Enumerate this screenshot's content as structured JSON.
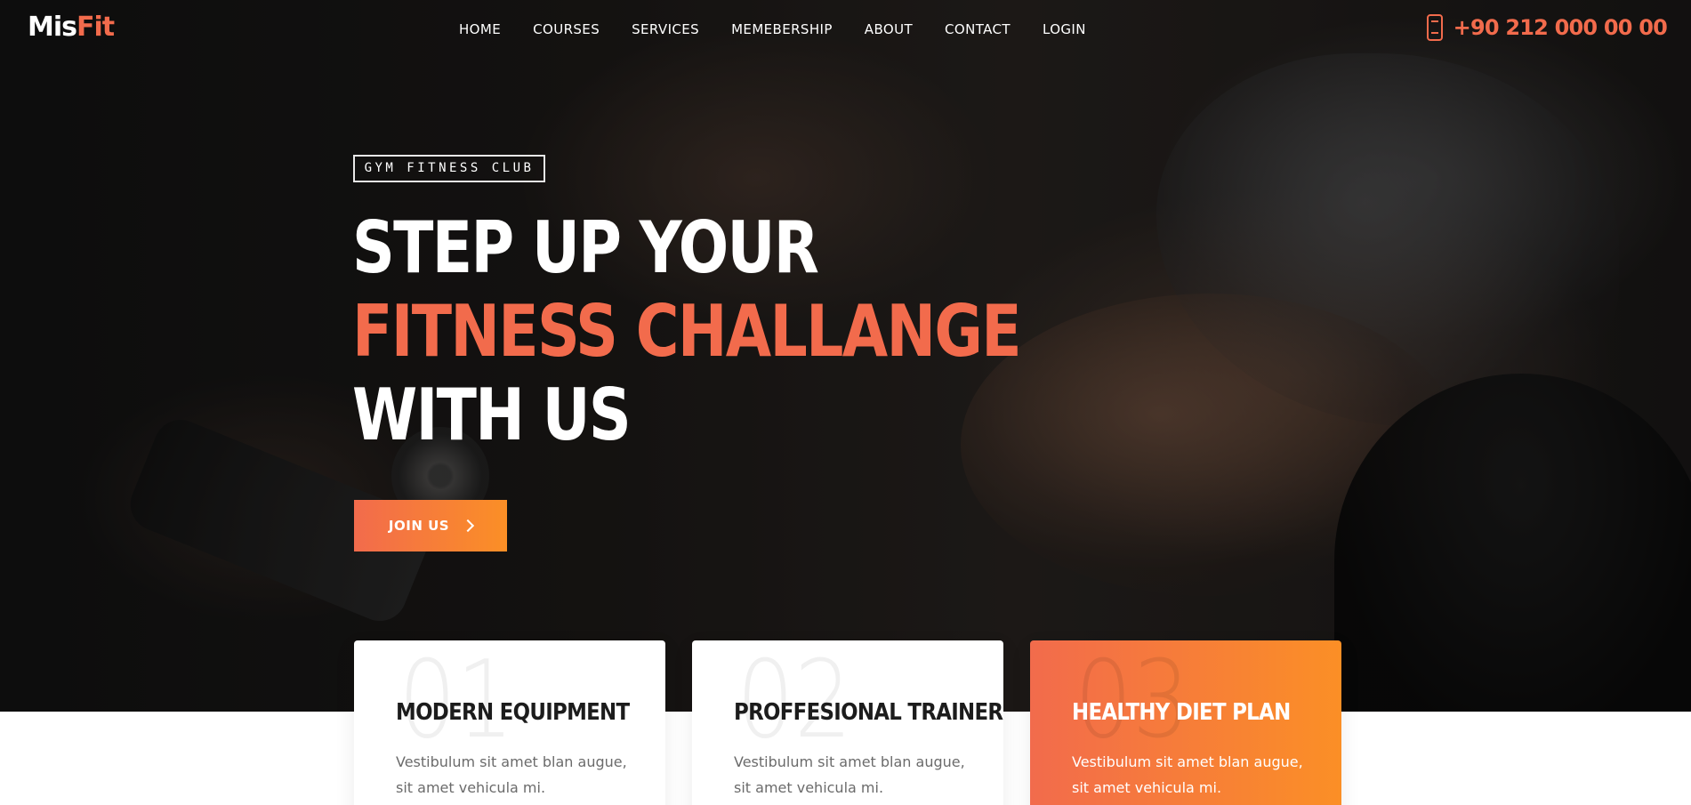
{
  "brand": {
    "logo_part1": "Mis",
    "logo_part2": "Fit"
  },
  "nav": {
    "items": [
      {
        "label": "HOME"
      },
      {
        "label": "COURSES"
      },
      {
        "label": "SERVICES"
      },
      {
        "label": "MEMEBERSHIP"
      },
      {
        "label": "ABOUT"
      },
      {
        "label": "CONTACT"
      },
      {
        "label": "LOGIN"
      }
    ]
  },
  "contact": {
    "phone": "+90 212 000 00 00",
    "icon": "phone-icon"
  },
  "hero": {
    "tag": "GYM FITNESS CLUB",
    "line1": "STEP UP YOUR",
    "line2": "FITNESS CHALLANGE",
    "line3": "WITH US",
    "cta_label": "JOIN US"
  },
  "features": [
    {
      "number": "01",
      "title": "MODERN EQUIPMENT",
      "text": "Vestibulum sit amet blan augue, sit amet vehicula mi."
    },
    {
      "number": "02",
      "title": "PROFFESIONAL TRAINER",
      "text": "Vestibulum sit amet blan augue, sit amet vehicula mi."
    },
    {
      "number": "03",
      "title": "HEALTHY DIET PLAN",
      "text": "Vestibulum sit amet blan augue, sit amet vehicula mi."
    }
  ],
  "colors": {
    "accent": "#f26b4c",
    "accent_end": "#fb8f26",
    "dark": "#1c1c1c"
  }
}
